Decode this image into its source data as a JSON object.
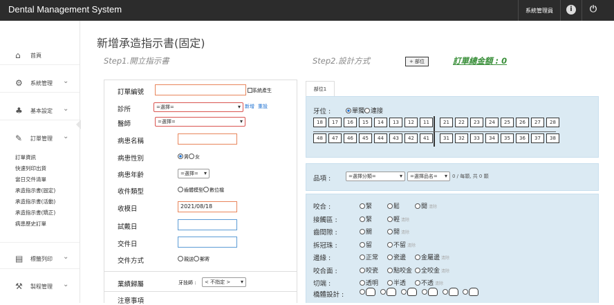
{
  "app": {
    "title": "Dental Management System",
    "user": "系統管理員"
  },
  "sidebar": {
    "home": "首頁",
    "sys": "系統管理",
    "basic": "基本設定",
    "orders": "訂單管理",
    "sub": [
      "訂單資訊",
      "快速列印出貨",
      "當日交件清單",
      "承造指示書(固定)",
      "承造指示書(活動)",
      "承造指示書(矯正)",
      "病患歷史訂單"
    ],
    "print": "標籤列印",
    "prod": "製程管理"
  },
  "page": {
    "title": "新增承造指示書(固定)",
    "step1": "Step1.開立指示書",
    "step2": "Step2.設計方式",
    "add_btn": "+ 部位",
    "total": "訂單總金額 : 0"
  },
  "form": {
    "order_no": "訂單編號",
    "auto": "系統產生",
    "clinic": "診所",
    "clinic_sel": "=選擇=",
    "new_link": "新增",
    "reset_link": "重設",
    "doctor": "醫師",
    "doctor_sel": "=選擇=",
    "patient": "病患名稱",
    "gender": "病患性別",
    "male": "男",
    "female": "女",
    "age": "病患年齡",
    "age_sel": "=選擇=",
    "recv_type": "收件類型",
    "rt1": "齒體模型",
    "rt2": "數位檔",
    "recv_date": "收模日",
    "recv_date_val": "2021/08/18",
    "try_date": "試戴日",
    "deliver_date": "交件日",
    "deliver_method": "交件方式",
    "dm1": "親送",
    "dm2": "郵寄",
    "perf": "業績歸屬",
    "tech": "牙技師 :",
    "tech_sel": "< 不指定 >",
    "notes": "注意事項"
  },
  "design": {
    "tab": "部位1",
    "tooth_pos": "牙位 :",
    "single": "單獨",
    "bridge": "連接",
    "upper": [
      "18",
      "17",
      "16",
      "15",
      "14",
      "13",
      "12",
      "11",
      "21",
      "22",
      "23",
      "24",
      "25",
      "26",
      "27",
      "28"
    ],
    "lower": [
      "48",
      "47",
      "46",
      "45",
      "44",
      "43",
      "42",
      "41",
      "31",
      "32",
      "33",
      "34",
      "35",
      "36",
      "37",
      "38"
    ],
    "item": "品項 :",
    "cat_sel": "=選擇分類=",
    "name_sel": "=選擇品名=",
    "count": "0 / 每顆, 共 0 顆",
    "opts": [
      {
        "label": "咬合 :",
        "o": [
          "緊",
          "鬆",
          "開"
        ]
      },
      {
        "label": "接觸區 :",
        "o": [
          "緊",
          "輕"
        ]
      },
      {
        "label": "齒間隙 :",
        "o": [
          "關",
          "開"
        ]
      },
      {
        "label": "拆冠珠 :",
        "o": [
          "留",
          "不留"
        ]
      },
      {
        "label": "邊緣 :",
        "o": [
          "正常",
          "瓷邊",
          "金屬邊"
        ]
      },
      {
        "label": "咬合面 :",
        "o": [
          "咬瓷",
          "點咬金",
          "全咬金"
        ]
      },
      {
        "label": "切端 :",
        "o": [
          "透明",
          "半透",
          "不透"
        ]
      }
    ],
    "bridge_design": "橋體設計 :",
    "clear": "清除"
  }
}
